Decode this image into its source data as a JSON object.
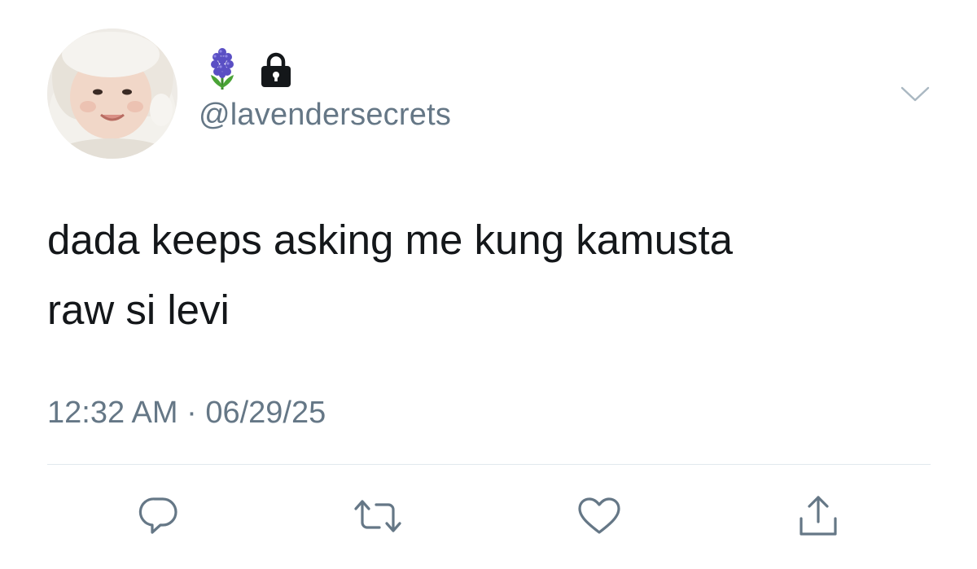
{
  "profile": {
    "handle": "@lavendersecrets",
    "avatar_icon": "avatar-photo",
    "name_icons": [
      "hyacinth-flower-icon",
      "lock-icon"
    ],
    "menu_icon": "chevron-down-icon"
  },
  "tweet": {
    "text_line_1": "dada keeps asking me kung kamusta",
    "text_line_2": "raw si levi",
    "time": "12:32 AM",
    "separator": "·",
    "date": "06/29/25"
  },
  "actions": [
    {
      "name": "reply",
      "icon": "reply-icon"
    },
    {
      "name": "retweet",
      "icon": "retweet-icon"
    },
    {
      "name": "like",
      "icon": "heart-icon"
    },
    {
      "name": "share",
      "icon": "share-icon"
    }
  ],
  "colors": {
    "text": "#14171a",
    "secondary": "#657786",
    "divider": "#e1e8ed",
    "icon": "#657786"
  }
}
